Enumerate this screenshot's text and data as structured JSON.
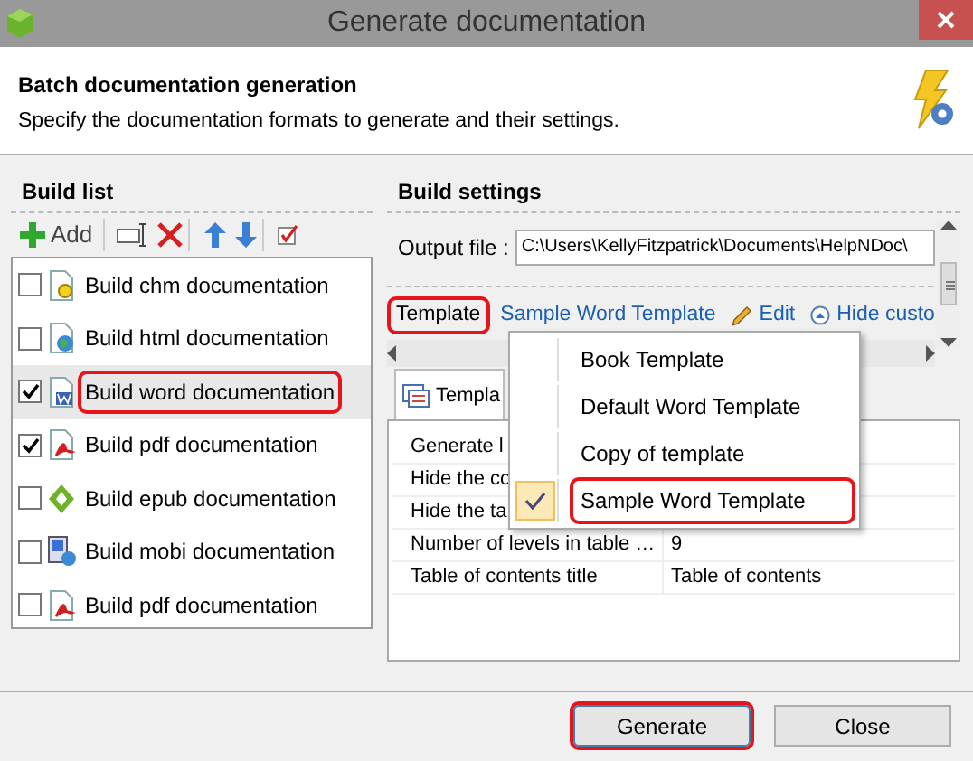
{
  "window": {
    "title": "Generate documentation"
  },
  "header": {
    "title": "Batch documentation generation",
    "subtitle": "Specify the documentation formats to generate and their settings."
  },
  "build_list": {
    "heading": "Build list",
    "add_label": "Add",
    "items": [
      {
        "label": "Build chm documentation",
        "kind": "chm",
        "checked": false,
        "selected": false,
        "highlighted": false
      },
      {
        "label": "Build html documentation",
        "kind": "html",
        "checked": false,
        "selected": false,
        "highlighted": false
      },
      {
        "label": "Build word documentation",
        "kind": "word",
        "checked": true,
        "selected": true,
        "highlighted": true
      },
      {
        "label": "Build pdf documentation",
        "kind": "pdf",
        "checked": true,
        "selected": false,
        "highlighted": false
      },
      {
        "label": "Build epub documentation",
        "kind": "epub",
        "checked": false,
        "selected": false,
        "highlighted": false
      },
      {
        "label": "Build mobi documentation",
        "kind": "mobi",
        "checked": false,
        "selected": false,
        "highlighted": false
      },
      {
        "label": "Build pdf documentation",
        "kind": "pdf",
        "checked": false,
        "selected": false,
        "highlighted": false
      }
    ]
  },
  "build_settings": {
    "heading": "Build settings",
    "output_label": "Output file :",
    "output_value": "C:\\Users\\KellyFitzpatrick\\Documents\\HelpNDoc\\",
    "template_label": "Template",
    "template_highlighted": true,
    "template_link": "Sample Word Template",
    "edit_link": "Edit",
    "hide_link": "Hide custo",
    "tab_label": "Templa",
    "properties": [
      {
        "name": "Generate l"
      },
      {
        "name": "Hide the co"
      },
      {
        "name": "Hide the ta"
      },
      {
        "name": "Number of levels in table …",
        "value": "9"
      },
      {
        "name": "Table of contents title",
        "value": "Table of contents"
      }
    ]
  },
  "template_menu": [
    {
      "label": "Book Template",
      "checked": false,
      "highlighted": false
    },
    {
      "label": "Default Word Template",
      "checked": false,
      "highlighted": false
    },
    {
      "label": "Copy of template",
      "checked": false,
      "highlighted": false
    },
    {
      "label": "Sample Word Template",
      "checked": true,
      "highlighted": true
    }
  ],
  "buttons": [
    {
      "label": "Generate",
      "default": true,
      "highlighted": true
    },
    {
      "label": "Close",
      "default": false,
      "highlighted": false
    }
  ]
}
